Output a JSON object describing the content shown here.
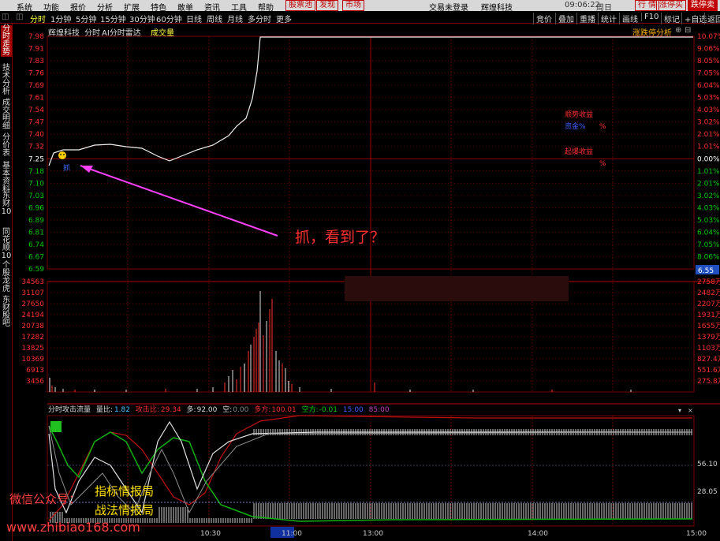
{
  "menubar": {
    "items": [
      "系统",
      "功能",
      "报价",
      "分析",
      "扩展",
      "特色",
      "敢单",
      "资讯",
      "工具",
      "帮助"
    ],
    "stock_pool": "股票池",
    "discover": "发现",
    "market": "市场",
    "trade_status": "交易未登录",
    "app_name": "辉煌科技",
    "time": "09:06:22",
    "weekday": "周日",
    "quote_btn": "行 情",
    "limit_up_buy": "涨停买",
    "limit_down_sell": "跌停卖"
  },
  "toolbar": {
    "tabs": [
      "分时",
      "1分钟",
      "5分钟",
      "15分钟",
      "30分钟",
      "60分钟",
      "日线",
      "周线",
      "月线",
      "多分时",
      "更多"
    ],
    "right": [
      "竞价",
      "叠加",
      "重播",
      "统计",
      "画线",
      "F10",
      "标记",
      "+自选",
      "返回"
    ]
  },
  "sidebar": {
    "tabs": [
      "分时走势",
      "技术分析",
      "成交明细",
      "分价表",
      "基本资料",
      "东财10",
      "同花顺10",
      "个股龙虎",
      "东财股吧"
    ]
  },
  "price_chart": {
    "stock_name": "辉煌科技",
    "mode": "分时",
    "radar": "AI分时雷达",
    "volume_label": "成交量",
    "limit_analysis": "涨跌停分析",
    "left_ticks": [
      "7.98",
      "7.91",
      "7.83",
      "7.76",
      "7.69",
      "7.61",
      "7.54",
      "7.47",
      "7.40",
      "7.32",
      "7.25",
      "7.18",
      "7.10",
      "7.03",
      "6.96",
      "6.89",
      "6.81",
      "6.74",
      "6.67",
      "6.59"
    ],
    "right_ticks": [
      "10.07%",
      "9.06%",
      "8.05%",
      "7.05%",
      "6.04%",
      "5.03%",
      "4.03%",
      "3.02%",
      "2.01%",
      "1.01%",
      "0.00%",
      "1.01%",
      "2.01%",
      "3.02%",
      "4.03%",
      "5.03%",
      "6.04%",
      "7.05%",
      "8.06%",
      "9.06%"
    ],
    "cursor_value": "6.55",
    "annot_1": "顺势收益",
    "annot_1_sub": "资金%",
    "annot_pct": "%",
    "annot_2": "起爆收益",
    "annot_2_pct": "%",
    "marker": "抓",
    "comment": "抓，看到了？"
  },
  "volume_chart": {
    "left_ticks": [
      "34563",
      "31107",
      "27650",
      "24194",
      "20738",
      "17282",
      "13825",
      "10369",
      "6913",
      "3456"
    ],
    "right_ticks": [
      "2758万",
      "2482万",
      "2207万",
      "1931万",
      "1655万",
      "1379万",
      "1103万",
      "827.4万",
      "551.6万",
      "275.8万"
    ]
  },
  "indicator": {
    "name": "分时攻击流量",
    "ratio_label": "量比:",
    "ratio": "1.82",
    "attack_label": "攻击比:",
    "attack": "29.34",
    "long_label": "多:",
    "long": "92.00",
    "empty_label": "空:",
    "empty": "0.00",
    "bull_label": "多方:",
    "bull": "100.01",
    "bear_label": "空方:",
    "bear": "-0.01",
    "v15": "15:00",
    "v85": "85:00",
    "right_ticks": [
      "56.10",
      "28.05"
    ]
  },
  "time_axis": [
    "10:30",
    "11:00",
    "13:00",
    "14:00",
    "15:00"
  ],
  "watermark": {
    "wechat": "微信公众号：",
    "name1": "指标情报局",
    "name2": "战法情报局",
    "url": "www.zhibiao168.com"
  },
  "colors": {
    "up": "#ff3030",
    "down": "#00c800",
    "grid": "#7a0000",
    "price": "#ffffff",
    "accent": "#ffff40"
  }
}
